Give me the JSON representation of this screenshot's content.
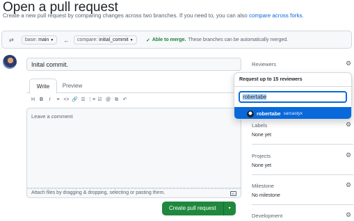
{
  "header": {
    "title": "Open a pull request",
    "subtitle_text": "Create a new pull request by comparing changes across two branches. If you need to, you can also",
    "subtitle_link": "compare across forks."
  },
  "compare_bar": {
    "base_prefix": "base:",
    "base_value": "main",
    "arrow": "←",
    "compare_prefix": "compare:",
    "compare_value": "initial_commit",
    "merge_status": "Able to merge.",
    "merge_detail": "These branches can be automatically merged."
  },
  "form": {
    "title_value": "Inital commit.",
    "tabs": [
      "Write",
      "Preview"
    ],
    "toolbar": [
      "H",
      "B",
      "I",
      "≡",
      "<>",
      "🔗",
      "☰",
      "⋮≡",
      "☑",
      "@",
      "⧉",
      "↶"
    ],
    "placeholder": "Leave a comment",
    "attach_text": "Attach files by dragging & dropping, selecting or pasting them.",
    "markdown_badge": "M↓",
    "create_label": "Create pull request",
    "create_dropdown": "▾"
  },
  "sidebar": {
    "reviewers": {
      "label": "Reviewers"
    },
    "labels": {
      "label": "Labels",
      "value": "None yet"
    },
    "projects": {
      "label": "Projects",
      "value": "None yet"
    },
    "milestone": {
      "label": "Milestone",
      "value": "No milestone"
    },
    "development": {
      "label": "Development"
    },
    "gear": "⚙"
  },
  "reviewer_popover": {
    "header": "Request up to 15 reviewers",
    "filter_value": "robertabe",
    "result_login": "robertabe",
    "result_name": "sarcastyx"
  }
}
